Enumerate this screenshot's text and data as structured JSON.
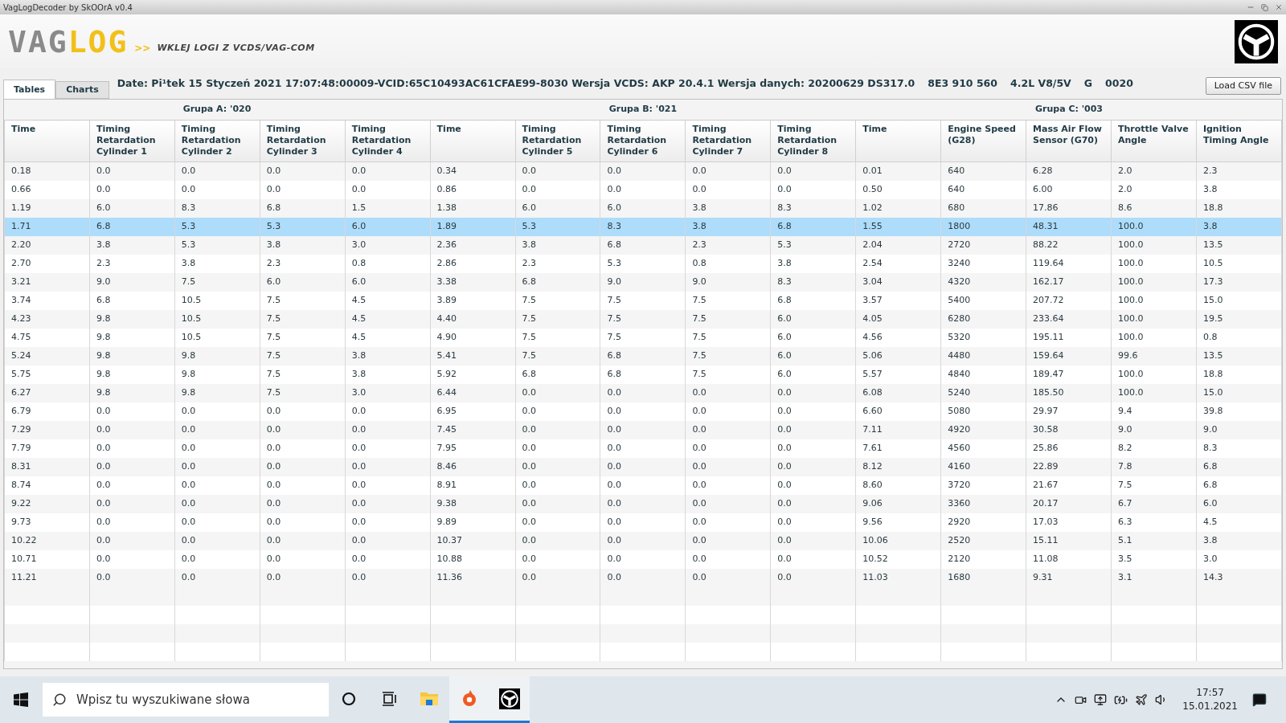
{
  "window": {
    "title": "VagLogDecoder by SkOOrA v0.4"
  },
  "header": {
    "logo": [
      "VAG",
      "LOG"
    ],
    "arrows": ">>",
    "tagline": "WKLEJ LOGI Z VCDS/VAG-COM"
  },
  "tabs": [
    {
      "label": "Tables",
      "selected": true
    },
    {
      "label": "Charts",
      "selected": false
    }
  ],
  "info": [
    "Date: Pi¹tek 15 Styczeń 2021 17:07:48:00009-VCID:65C10493AC61CFAE99-8030 Wersja VCDS: AKP 20.4.1 Wersja danych: 20200629 DS317.0",
    "8E3 910 560",
    "4.2L V8/5V",
    "G",
    "0020"
  ],
  "load_button": "Load CSV file",
  "table": {
    "groups": [
      "Grupa A: '020",
      "Grupa B: '021",
      "Grupa C: '003"
    ],
    "columns": [
      "Time",
      "Timing Retardation Cylinder 1",
      "Timing Retardation Cylinder 2",
      "Timing Retardation Cylinder 3",
      "Timing Retardation Cylinder 4",
      "Time",
      "Timing Retardation Cylinder 5",
      "Timing Retardation Cylinder 6",
      "Timing Retardation Cylinder 7",
      "Timing Retardation Cylinder 8",
      "Time",
      "Engine Speed (G28)",
      "Mass Air Flow Sensor (G70)",
      "Throttle Valve Angle",
      "Ignition Timing Angle"
    ],
    "rows": [
      {
        "selected": false,
        "cells": [
          "0.18",
          "0.0",
          "0.0",
          "0.0",
          "0.0",
          "0.34",
          "0.0",
          "0.0",
          "0.0",
          "0.0",
          "0.01",
          "640",
          "6.28",
          "2.0",
          "2.3"
        ]
      },
      {
        "selected": false,
        "cells": [
          "0.66",
          "0.0",
          "0.0",
          "0.0",
          "0.0",
          "0.86",
          "0.0",
          "0.0",
          "0.0",
          "0.0",
          "0.50",
          "640",
          "6.00",
          "2.0",
          "3.8"
        ]
      },
      {
        "selected": false,
        "cells": [
          "1.19",
          "6.0",
          "8.3",
          "6.8",
          "1.5",
          "1.38",
          "6.0",
          "6.0",
          "3.8",
          "8.3",
          "1.02",
          "680",
          "17.86",
          "8.6",
          "18.8"
        ]
      },
      {
        "selected": true,
        "cells": [
          "1.71",
          "6.8",
          "5.3",
          "5.3",
          "6.0",
          "1.89",
          "5.3",
          "8.3",
          "3.8",
          "6.8",
          "1.55",
          "1800",
          "48.31",
          "100.0",
          "3.8"
        ]
      },
      {
        "selected": false,
        "cells": [
          "2.20",
          "3.8",
          "5.3",
          "3.8",
          "3.0",
          "2.36",
          "3.8",
          "6.8",
          "2.3",
          "5.3",
          "2.04",
          "2720",
          "88.22",
          "100.0",
          "13.5"
        ]
      },
      {
        "selected": false,
        "cells": [
          "2.70",
          "2.3",
          "3.8",
          "2.3",
          "0.8",
          "2.86",
          "2.3",
          "5.3",
          "0.8",
          "3.8",
          "2.54",
          "3240",
          "119.64",
          "100.0",
          "10.5"
        ]
      },
      {
        "selected": false,
        "cells": [
          "3.21",
          "9.0",
          "7.5",
          "6.0",
          "6.0",
          "3.38",
          "6.8",
          "9.0",
          "9.0",
          "8.3",
          "3.04",
          "4320",
          "162.17",
          "100.0",
          "17.3"
        ]
      },
      {
        "selected": false,
        "cells": [
          "3.74",
          "6.8",
          "10.5",
          "7.5",
          "4.5",
          "3.89",
          "7.5",
          "7.5",
          "7.5",
          "6.8",
          "3.57",
          "5400",
          "207.72",
          "100.0",
          "15.0"
        ]
      },
      {
        "selected": false,
        "cells": [
          "4.23",
          "9.8",
          "10.5",
          "7.5",
          "4.5",
          "4.40",
          "7.5",
          "7.5",
          "7.5",
          "6.0",
          "4.05",
          "6280",
          "233.64",
          "100.0",
          "19.5"
        ]
      },
      {
        "selected": false,
        "cells": [
          "4.75",
          "9.8",
          "10.5",
          "7.5",
          "4.5",
          "4.90",
          "7.5",
          "7.5",
          "7.5",
          "6.0",
          "4.56",
          "5320",
          "195.11",
          "100.0",
          "0.8"
        ]
      },
      {
        "selected": false,
        "cells": [
          "5.24",
          "9.8",
          "9.8",
          "7.5",
          "3.8",
          "5.41",
          "7.5",
          "6.8",
          "7.5",
          "6.0",
          "5.06",
          "4480",
          "159.64",
          "99.6",
          "13.5"
        ]
      },
      {
        "selected": false,
        "cells": [
          "5.75",
          "9.8",
          "9.8",
          "7.5",
          "3.8",
          "5.92",
          "6.8",
          "6.8",
          "7.5",
          "6.0",
          "5.57",
          "4840",
          "189.47",
          "100.0",
          "18.8"
        ]
      },
      {
        "selected": false,
        "cells": [
          "6.27",
          "9.8",
          "9.8",
          "7.5",
          "3.0",
          "6.44",
          "0.0",
          "0.0",
          "0.0",
          "0.0",
          "6.08",
          "5240",
          "185.50",
          "100.0",
          "15.0"
        ]
      },
      {
        "selected": false,
        "cells": [
          "6.79",
          "0.0",
          "0.0",
          "0.0",
          "0.0",
          "6.95",
          "0.0",
          "0.0",
          "0.0",
          "0.0",
          "6.60",
          "5080",
          "29.97",
          "9.4",
          "39.8"
        ]
      },
      {
        "selected": false,
        "cells": [
          "7.29",
          "0.0",
          "0.0",
          "0.0",
          "0.0",
          "7.45",
          "0.0",
          "0.0",
          "0.0",
          "0.0",
          "7.11",
          "4920",
          "30.58",
          "9.0",
          "9.0"
        ]
      },
      {
        "selected": false,
        "cells": [
          "7.79",
          "0.0",
          "0.0",
          "0.0",
          "0.0",
          "7.95",
          "0.0",
          "0.0",
          "0.0",
          "0.0",
          "7.61",
          "4560",
          "25.86",
          "8.2",
          "8.3"
        ]
      },
      {
        "selected": false,
        "cells": [
          "8.31",
          "0.0",
          "0.0",
          "0.0",
          "0.0",
          "8.46",
          "0.0",
          "0.0",
          "0.0",
          "0.0",
          "8.12",
          "4160",
          "22.89",
          "7.8",
          "6.8"
        ]
      },
      {
        "selected": false,
        "cells": [
          "8.74",
          "0.0",
          "0.0",
          "0.0",
          "0.0",
          "8.91",
          "0.0",
          "0.0",
          "0.0",
          "0.0",
          "8.60",
          "3720",
          "21.67",
          "7.5",
          "6.8"
        ]
      },
      {
        "selected": false,
        "cells": [
          "9.22",
          "0.0",
          "0.0",
          "0.0",
          "0.0",
          "9.38",
          "0.0",
          "0.0",
          "0.0",
          "0.0",
          "9.06",
          "3360",
          "20.17",
          "6.7",
          "6.0"
        ]
      },
      {
        "selected": false,
        "cells": [
          "9.73",
          "0.0",
          "0.0",
          "0.0",
          "0.0",
          "9.89",
          "0.0",
          "0.0",
          "0.0",
          "0.0",
          "9.56",
          "2920",
          "17.03",
          "6.3",
          "4.5"
        ]
      },
      {
        "selected": false,
        "cells": [
          "10.22",
          "0.0",
          "0.0",
          "0.0",
          "0.0",
          "10.37",
          "0.0",
          "0.0",
          "0.0",
          "0.0",
          "10.06",
          "2520",
          "15.11",
          "5.1",
          "3.8"
        ]
      },
      {
        "selected": false,
        "cells": [
          "10.71",
          "0.0",
          "0.0",
          "0.0",
          "0.0",
          "10.88",
          "0.0",
          "0.0",
          "0.0",
          "0.0",
          "10.52",
          "2120",
          "11.08",
          "3.5",
          "3.0"
        ]
      },
      {
        "selected": false,
        "cells": [
          "11.21",
          "0.0",
          "0.0",
          "0.0",
          "0.0",
          "11.36",
          "0.0",
          "0.0",
          "0.0",
          "0.0",
          "11.03",
          "1680",
          "9.31",
          "3.1",
          "14.3"
        ]
      }
    ]
  },
  "taskbar": {
    "search_placeholder": "Wpisz tu wyszukiwane słowa",
    "apps": [
      {
        "kind": "cortana",
        "active": false
      },
      {
        "kind": "taskview",
        "active": false
      },
      {
        "kind": "folder",
        "active": false
      },
      {
        "kind": "origin",
        "active": true
      },
      {
        "kind": "vaglog",
        "active": true
      }
    ],
    "time": "17:57",
    "date": "15.01.2021"
  }
}
